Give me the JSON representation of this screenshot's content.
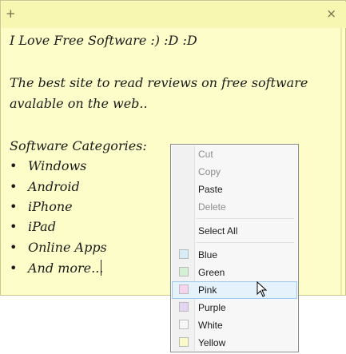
{
  "note": {
    "add_button": "+",
    "close_button": "×",
    "lines": [
      "I Love Free Software :) :D :D",
      "The best site to read reviews on free software",
      "avalable on the web..",
      "Software Categories:"
    ],
    "bullet_glyph": "•",
    "categories": [
      "Windows",
      "Android",
      "iPhone",
      "iPad",
      "Online Apps",
      "And more..."
    ],
    "color": "#fdfdc9"
  },
  "context_menu": {
    "items": {
      "cut": "Cut",
      "copy": "Copy",
      "paste": "Paste",
      "delete": "Delete",
      "select_all": "Select All"
    },
    "colors": [
      {
        "label": "Blue",
        "swatch": "#d6ecf7"
      },
      {
        "label": "Green",
        "swatch": "#d3f1d3"
      },
      {
        "label": "Pink",
        "swatch": "#f4d4ee"
      },
      {
        "label": "Purple",
        "swatch": "#e2d6f3"
      },
      {
        "label": "White",
        "swatch": "#f7f7f7"
      },
      {
        "label": "Yellow",
        "swatch": "#fafac8"
      }
    ],
    "hovered_item": "Pink"
  }
}
